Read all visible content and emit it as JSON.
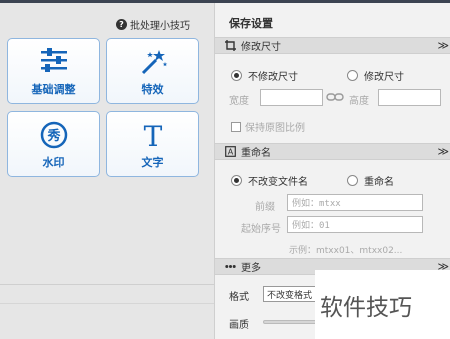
{
  "left": {
    "tips_label": "批处理小技巧",
    "tools": [
      {
        "label": "基础调整",
        "icon": "sliders-icon"
      },
      {
        "label": "特效",
        "icon": "magic-wand-icon"
      },
      {
        "label": "水印",
        "icon": "watermark-icon"
      },
      {
        "label": "文字",
        "icon": "text-icon"
      }
    ],
    "text_icon_glyph": "T",
    "watermark_icon_glyph": "秀"
  },
  "right": {
    "title": "保存设置",
    "resize": {
      "header": "修改尺寸",
      "option_no_resize": "不修改尺寸",
      "option_resize": "修改尺寸",
      "width_label": "宽度",
      "height_label": "高度",
      "keep_ratio_label": "保持原图比例"
    },
    "rename": {
      "header": "重命名",
      "option_keep": "不改变文件名",
      "option_rename": "重命名",
      "prefix_label": "前缀",
      "prefix_placeholder": "例如：mtxx",
      "start_label": "起始序号",
      "start_placeholder": "例如：01",
      "example_text": "示例：mtxx01、mtxx02..."
    },
    "more": {
      "header": "更多",
      "format_label": "格式",
      "format_value": "不改变格式",
      "quality_label": "画质"
    },
    "chevron_glyph": "≫"
  },
  "watermark_text": "软件技巧",
  "colors": {
    "accent": "#1565b9",
    "tool_border": "#8fb6df"
  }
}
